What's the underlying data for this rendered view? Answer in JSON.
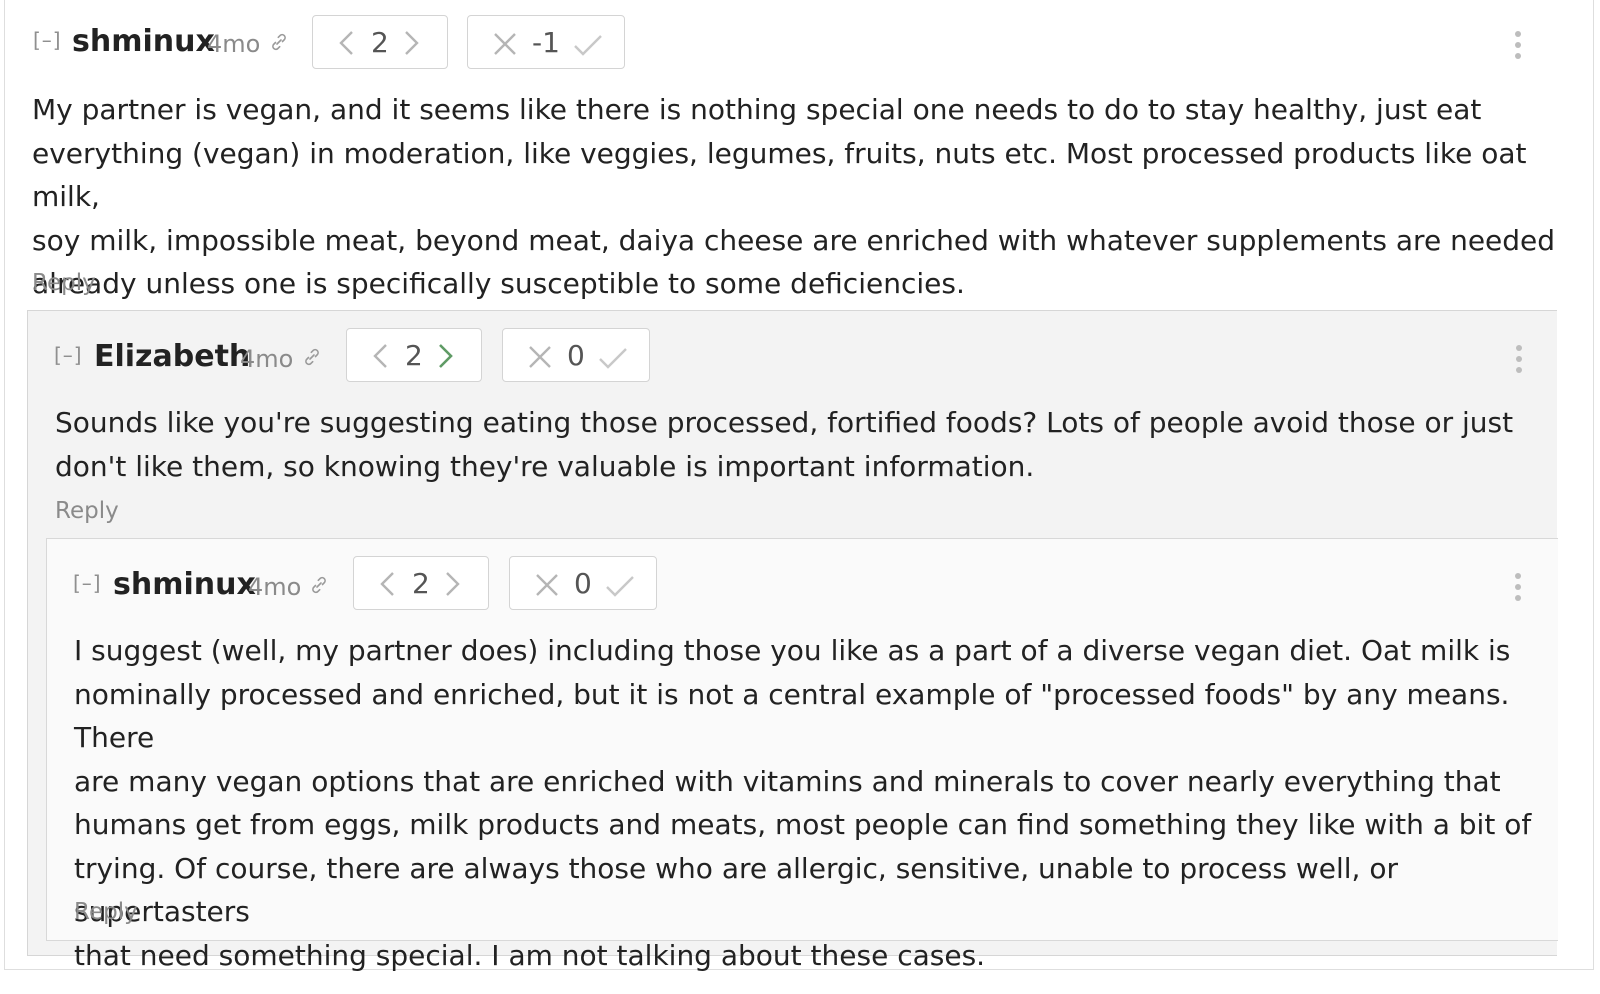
{
  "comments": [
    {
      "collapse": "[–]",
      "author": "shminux",
      "age": "4mo",
      "karma": "2",
      "agreement": "-1",
      "body_lines": [
        "My partner is vegan, and it seems like there is nothing special one needs to do to stay healthy, just eat",
        "everything (vegan) in moderation, like veggies, legumes, fruits, nuts etc. Most processed products like oat milk,",
        "soy milk, impossible meat, beyond meat, daiya cheese are enriched with whatever supplements are needed",
        "already unless one is specifically susceptible to some deficiencies."
      ],
      "reply": "Reply"
    },
    {
      "collapse": "[–]",
      "author": "Elizabeth",
      "age": "4mo",
      "karma": "2",
      "agreement": "0",
      "body_lines": [
        "Sounds like you're suggesting eating those processed, fortified foods? Lots of people avoid those or just",
        "don't like them, so knowing they're valuable is important information."
      ],
      "reply": "Reply"
    },
    {
      "collapse": "[–]",
      "author": "shminux",
      "age": "4mo",
      "karma": "2",
      "agreement": "0",
      "body_lines": [
        "I suggest (well, my partner does) including those you like as a part of a diverse vegan diet. Oat milk is",
        "nominally processed and enriched, but it is not a central example of \"processed foods\" by any means. There",
        "are many vegan options that are enriched with vitamins and minerals to cover nearly everything that",
        "humans get from eggs, milk products and meats, most people can find something they like with a bit of",
        "trying. Of course, there are always those who are allergic, sensitive, unable to process well, or supertasters",
        "that need something special. I am not talking about these cases."
      ],
      "reply": "Reply"
    }
  ],
  "colors": {
    "upvote_active": "#5f9b65",
    "border": "#d6d6d6",
    "muted_text": "#8a8a8a"
  },
  "icons": [
    "link-icon",
    "chevron-left-icon",
    "chevron-right-icon",
    "x-disagree-icon",
    "check-agree-icon",
    "kebab-menu-icon"
  ]
}
